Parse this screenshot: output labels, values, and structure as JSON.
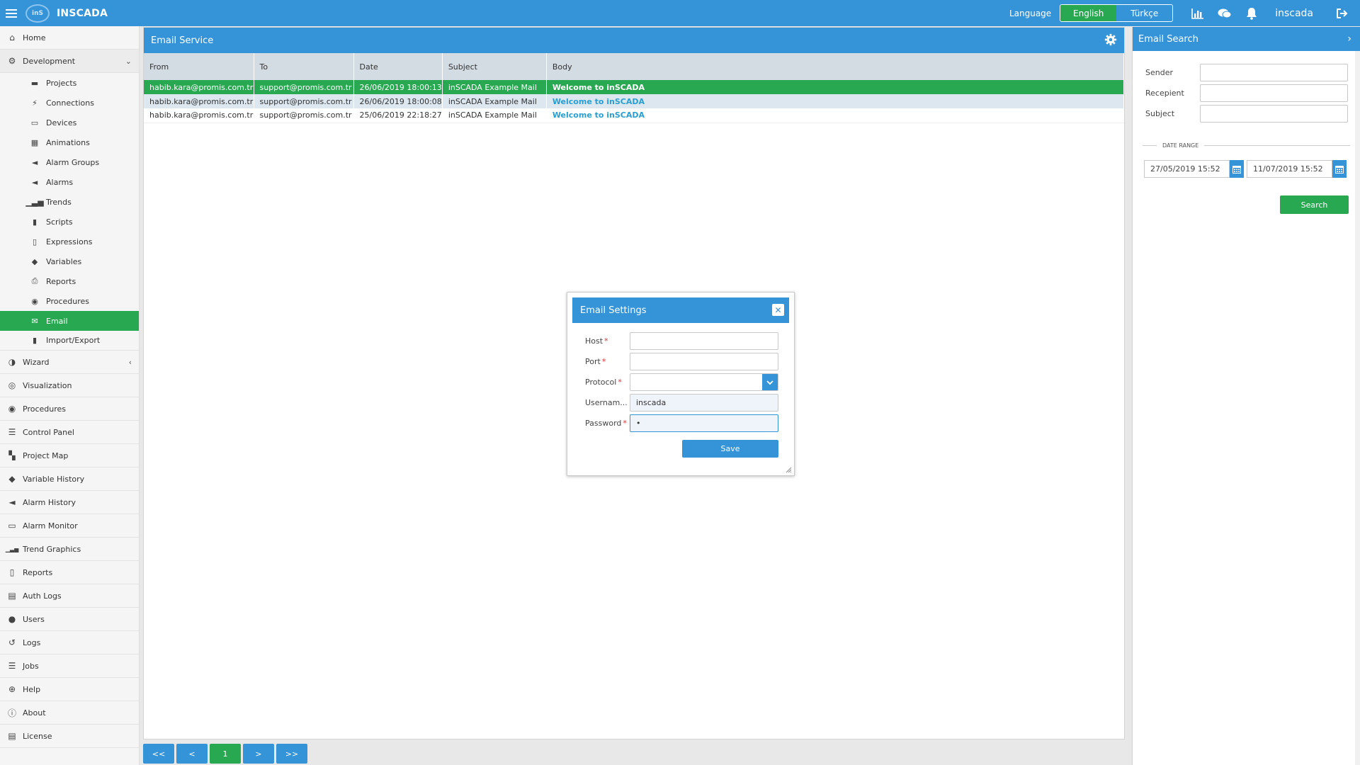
{
  "app": {
    "brand": "INSCADA",
    "logo_text": "inS"
  },
  "topbar": {
    "language_label": "Language",
    "languages": [
      {
        "label": "English",
        "active": true
      },
      {
        "label": "Türkçe",
        "active": false
      }
    ],
    "icons": [
      "bar-chart-icon",
      "chat-icon",
      "bell-icon"
    ],
    "username": "inscada",
    "logout_icon": "logout-icon"
  },
  "sidebar": {
    "items": [
      {
        "label": "Home",
        "icon": "home-icon"
      },
      {
        "label": "Development",
        "icon": "development-icon",
        "expanded": true
      },
      {
        "label": "Wizard",
        "icon": "wizard-icon"
      },
      {
        "label": "Visualization",
        "icon": "visualization-icon"
      },
      {
        "label": "Procedures",
        "icon": "procedures-icon"
      },
      {
        "label": "Control Panel",
        "icon": "control-panel-icon"
      },
      {
        "label": "Project Map",
        "icon": "map-icon"
      },
      {
        "label": "Variable History",
        "icon": "tag-icon"
      },
      {
        "label": "Alarm History",
        "icon": "megaphone-icon"
      },
      {
        "label": "Alarm Monitor",
        "icon": "monitor-icon"
      },
      {
        "label": "Trend Graphics",
        "icon": "trend-icon"
      },
      {
        "label": "Reports",
        "icon": "report-icon"
      },
      {
        "label": "Auth Logs",
        "icon": "auth-log-icon"
      },
      {
        "label": "Users",
        "icon": "user-icon"
      },
      {
        "label": "Logs",
        "icon": "history-icon"
      },
      {
        "label": "Jobs",
        "icon": "jobs-icon"
      },
      {
        "label": "Help",
        "icon": "help-icon"
      },
      {
        "label": "About",
        "icon": "info-icon"
      },
      {
        "label": "License",
        "icon": "license-icon"
      }
    ],
    "dev_subitems": [
      {
        "label": "Projects",
        "icon": "briefcase-icon"
      },
      {
        "label": "Connections",
        "icon": "plug-icon"
      },
      {
        "label": "Devices",
        "icon": "desktop-icon"
      },
      {
        "label": "Animations",
        "icon": "film-icon"
      },
      {
        "label": "Alarm Groups",
        "icon": "megaphone-icon"
      },
      {
        "label": "Alarms",
        "icon": "megaphone-icon"
      },
      {
        "label": "Trends",
        "icon": "trend-icon"
      },
      {
        "label": "Scripts",
        "icon": "file-icon"
      },
      {
        "label": "Expressions",
        "icon": "code-file-icon"
      },
      {
        "label": "Variables",
        "icon": "tags-icon"
      },
      {
        "label": "Reports",
        "icon": "print-icon"
      },
      {
        "label": "Procedures",
        "icon": "procedure-icon"
      },
      {
        "label": "Email",
        "icon": "email-icon",
        "active": true
      },
      {
        "label": "Import/Export",
        "icon": "file-icon"
      }
    ]
  },
  "email_service": {
    "title": "Email Service",
    "columns": [
      "From",
      "To",
      "Date",
      "Subject",
      "Body"
    ],
    "rows": [
      {
        "from": "habib.kara@promis.com.tr",
        "to": "support@promis.com.tr",
        "date": "26/06/2019 18:00:13",
        "subject": "inSCADA Example Mail",
        "body": "Welcome to inSCADA",
        "state": "selected"
      },
      {
        "from": "habib.kara@promis.com.tr",
        "to": "support@promis.com.tr",
        "date": "26/06/2019 18:00:08",
        "subject": "inSCADA Example Mail",
        "body": "Welcome to inSCADA",
        "state": "alt"
      },
      {
        "from": "habib.kara@promis.com.tr",
        "to": "support@promis.com.tr",
        "date": "25/06/2019 22:18:27",
        "subject": "inSCADA Example Mail",
        "body": "Welcome to inSCADA",
        "state": "normal"
      }
    ]
  },
  "pager": {
    "first": "<<",
    "prev": "<",
    "page": "1",
    "next": ">",
    "last": ">>"
  },
  "email_search": {
    "title": "Email Search",
    "sender_label": "Sender",
    "recipient_label": "Recepient",
    "subject_label": "Subject",
    "date_range_label": "DATE RANGE",
    "date_from": "27/05/2019 15:52",
    "date_to": "11/07/2019 15:52",
    "search_label": "Search"
  },
  "dialog": {
    "title": "Email Settings",
    "host_label": "Host",
    "port_label": "Port",
    "protocol_label": "Protocol",
    "username_label": "Usernam...",
    "username_value": "inscada",
    "password_label": "Password",
    "password_value": "•",
    "required_mark": "*",
    "save_label": "Save"
  },
  "colors": {
    "primary": "#3593d7",
    "success": "#27a851",
    "row_alt": "#dde7f0",
    "header": "#d3dbe3"
  }
}
